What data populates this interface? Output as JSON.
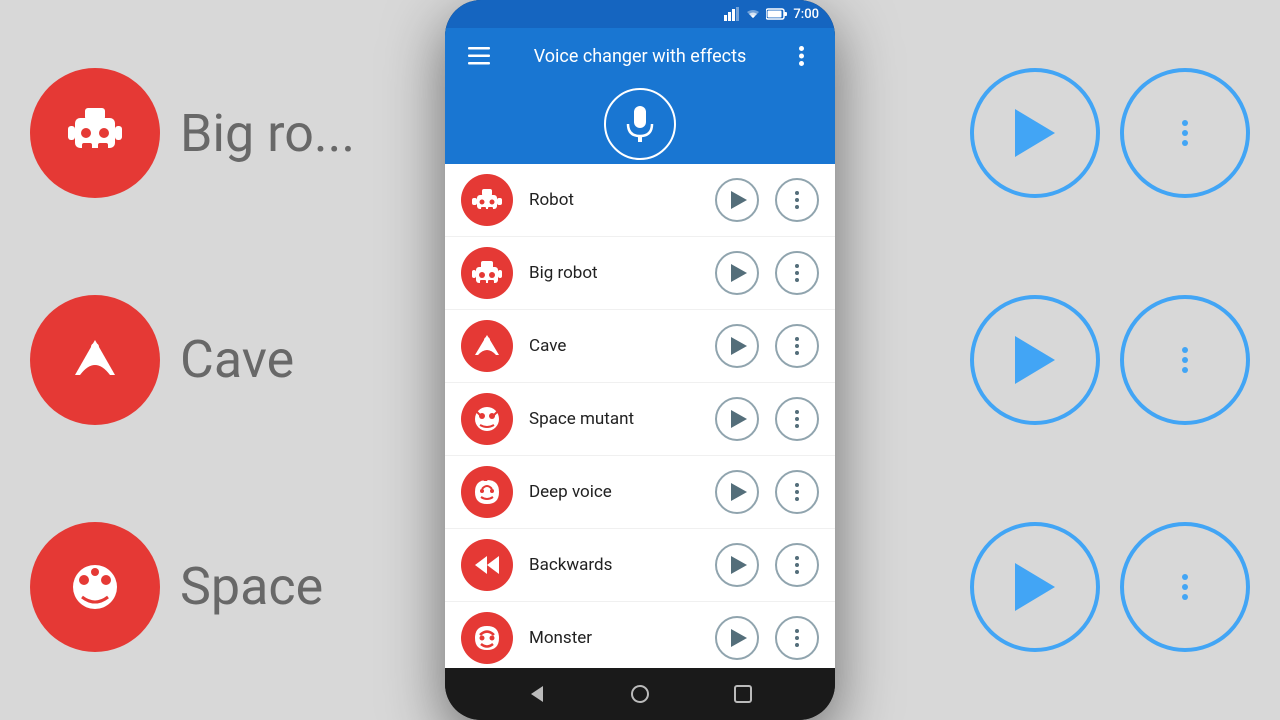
{
  "app": {
    "title": "Voice changer with effects",
    "time": "7:00"
  },
  "header": {
    "menu_icon": "≡",
    "more_icon": "⋮"
  },
  "effects": [
    {
      "id": "robot",
      "name": "Robot",
      "icon": "🤖"
    },
    {
      "id": "big-robot",
      "name": "Big robot",
      "icon": "🤖"
    },
    {
      "id": "cave",
      "name": "Cave",
      "icon": "🏔"
    },
    {
      "id": "space-mutant",
      "name": "Space mutant",
      "icon": "👾"
    },
    {
      "id": "deep-voice",
      "name": "Deep voice",
      "icon": "😈"
    },
    {
      "id": "backwards",
      "name": "Backwards",
      "icon": "⏪"
    },
    {
      "id": "monster",
      "name": "Monster",
      "icon": "😠"
    }
  ],
  "nav": {
    "back": "◁",
    "home": "○",
    "recent": "□"
  },
  "bg": {
    "left_labels": [
      "Big ro...",
      "Cave",
      "Space"
    ],
    "colors": {
      "primary": "#1976d2",
      "accent": "#e53935",
      "outline": "#42a5f5"
    }
  }
}
